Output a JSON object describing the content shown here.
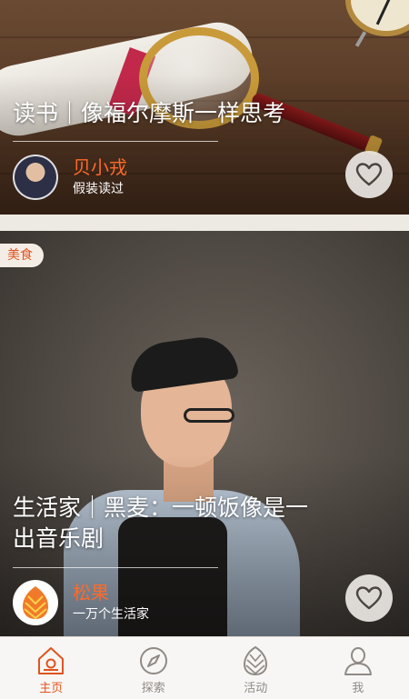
{
  "feed": {
    "cards": [
      {
        "title": "读书｜像福尔摩斯一样思考",
        "author_name": "贝小戎",
        "author_subtitle": "假装读过"
      },
      {
        "tag": "美食",
        "title_line1": "生活家｜黑麦：一顿饭像是一",
        "title_line2": "出音乐剧",
        "author_name": "松果",
        "author_subtitle": "一万个生活家"
      }
    ]
  },
  "tabbar": {
    "tabs": [
      {
        "label": "主页",
        "icon": "home-icon",
        "active": true
      },
      {
        "label": "探索",
        "icon": "compass-icon",
        "active": false
      },
      {
        "label": "活动",
        "icon": "pinecone-icon",
        "active": false
      },
      {
        "label": "我",
        "icon": "user-icon",
        "active": false
      }
    ]
  },
  "colors": {
    "accent": "#e0541f",
    "author_name": "#ff6a2a",
    "tab_inactive": "#8f8a86",
    "background": "#ede9e3"
  }
}
